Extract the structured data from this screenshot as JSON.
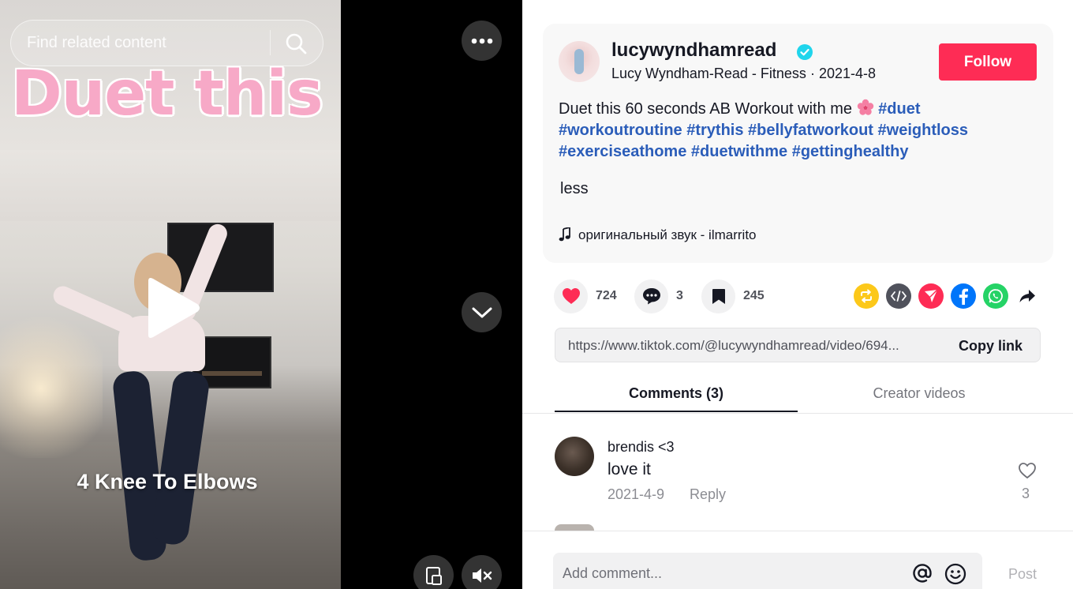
{
  "video": {
    "search_placeholder": "Find related content",
    "overlay_title": "Duet this",
    "caption": "4 Knee To Elbows",
    "icons": [
      "search-icon",
      "more-icon",
      "play-icon",
      "chevron-down-icon",
      "pip-icon",
      "mute-icon"
    ]
  },
  "author": {
    "username": "lucywyndhamread",
    "verified": true,
    "display_name": "Lucy Wyndham-Read - Fitness",
    "date": "2021-4-8",
    "follow_label": "Follow"
  },
  "description": {
    "text": "Duet this 60 seconds AB Workout with me",
    "tags": [
      "#duet",
      "#workoutroutine",
      "#trythis",
      "#bellyfatworkout",
      "#weightloss",
      "#exerciseathome",
      "#duetwithme",
      "#gettinghealthy"
    ],
    "toggle_label": "less"
  },
  "music": {
    "title": "оригинальный звук - ilmarrito"
  },
  "stats": {
    "likes": "724",
    "comments": "3",
    "saves": "245"
  },
  "share": {
    "icons": [
      "repost-icon",
      "embed-icon",
      "send-icon",
      "facebook-icon",
      "whatsapp-icon",
      "share-arrow-icon"
    ]
  },
  "link": {
    "url": "https://www.tiktok.com/@lucywyndhamread/video/694...",
    "copy_label": "Copy link"
  },
  "tabs": {
    "comments": "Comments (3)",
    "creator_videos": "Creator videos"
  },
  "comments": [
    {
      "user": "brendis <3",
      "text": "love it",
      "date": "2021-4-9",
      "reply_label": "Reply",
      "likes": "3"
    }
  ],
  "composer": {
    "placeholder": "Add comment...",
    "post_label": "Post"
  },
  "colors": {
    "accent": "#fe2c55",
    "hashtag": "#2b5db9",
    "overlay_pink": "#f7a9c7"
  }
}
